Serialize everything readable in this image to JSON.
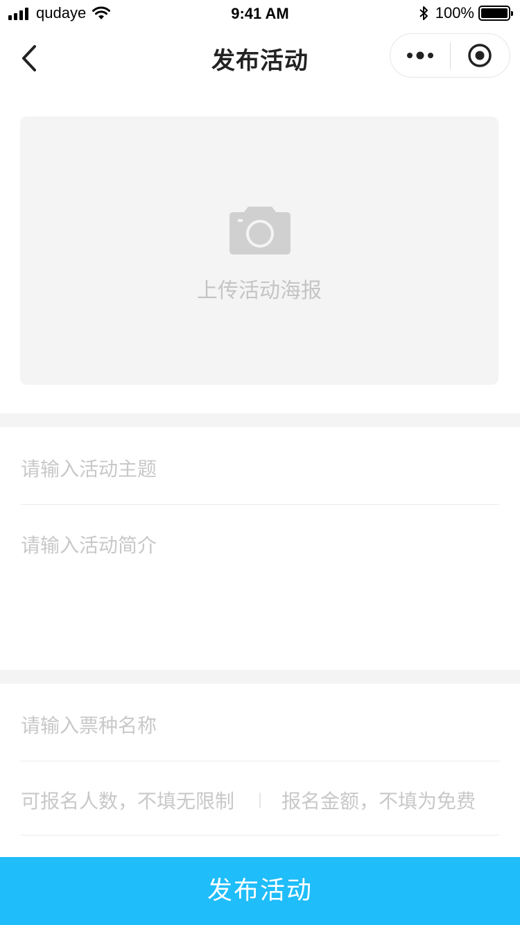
{
  "status_bar": {
    "carrier": "qudaye",
    "time": "9:41 AM",
    "battery": "100%"
  },
  "nav": {
    "title": "发布活动",
    "back_icon": "chevron-left-icon",
    "more_icon": "more-dots-icon",
    "close_icon": "target-circle-icon"
  },
  "poster": {
    "label": "上传活动海报",
    "icon": "camera-icon"
  },
  "form": {
    "theme_placeholder": "请输入活动主题",
    "intro_placeholder": "请输入活动简介",
    "ticket_name_placeholder": "请输入票种名称",
    "capacity_placeholder": "可报名人数，不填无限制",
    "price_placeholder": "报名金额，不填为免费"
  },
  "submit_label": "发布活动",
  "colors": {
    "primary": "#1fbdf9",
    "placeholder": "#c8c8c8",
    "band": "#f4f4f4"
  }
}
